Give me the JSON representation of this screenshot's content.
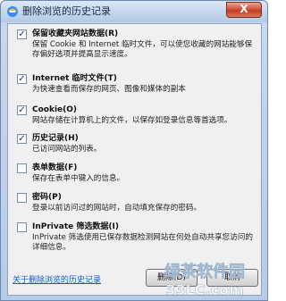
{
  "window": {
    "title": "删除浏览的历史记录",
    "close_label": "X"
  },
  "options": [
    {
      "checked": true,
      "title": "保留收藏夹网站数据(R)",
      "desc": "保留 Cookie 和 Internet 临时文件，可以使您收藏的网站能够保存偏好选项并提高显示速度。"
    },
    {
      "checked": true,
      "title": "Internet 临时文件(T)",
      "desc": "为快速查看而保存的网页、图像和媒体的副本"
    },
    {
      "checked": true,
      "title": "Cookie(O)",
      "desc": "网站存储在计算机上的文件，以保存如登录信息等首选项。"
    },
    {
      "checked": true,
      "title": "历史记录(H)",
      "desc": "已访问网站的列表。"
    },
    {
      "checked": false,
      "title": "表单数据(F)",
      "desc": "保存在表单中键入的信息。"
    },
    {
      "checked": false,
      "title": "密码(P)",
      "desc": "登录以前访问过的网站时，自动填充保存的密码。"
    },
    {
      "checked": false,
      "title": "InPrivate 筛选数据(I)",
      "desc": "InPrivate 筛选使用已保存数据检测网站在何处自动共享您访问的详细信息。"
    }
  ],
  "footer": {
    "link": "关于删除浏览的历史记录",
    "delete_label": "删除(D)",
    "cancel_label": "取消"
  },
  "watermark": {
    "line1": "绿茶软件园",
    "line2": "33LC.com"
  },
  "colors": {
    "link": "#1a57c9",
    "title_bar": "#c3d5ec",
    "close_button": "#c23b22"
  }
}
